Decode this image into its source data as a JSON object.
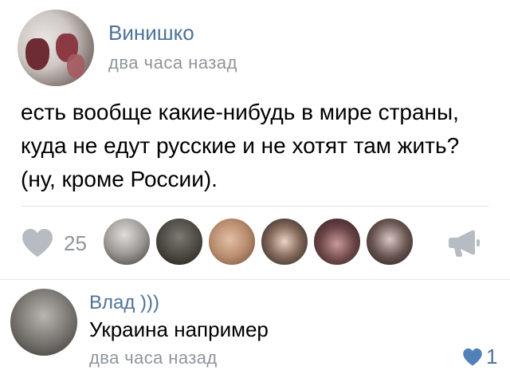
{
  "post": {
    "group_name": "Винишко",
    "time": "два часа назад",
    "text": "есть вообще какие-нибудь в мире страны, куда не едут русские и не хотят там жить? (ну, кроме России).",
    "likes_count": "25",
    "liker_avatars": [
      "liker-avatar",
      "liker-avatar",
      "liker-avatar",
      "liker-avatar",
      "liker-avatar",
      "liker-avatar"
    ],
    "icons": {
      "like": "heart-icon",
      "share": "megaphone-icon"
    }
  },
  "comment": {
    "author": "Влад )))",
    "text": "Украина например",
    "time": "два часа назад",
    "likes_count": "1",
    "icons": {
      "like": "heart-icon"
    }
  },
  "colors": {
    "accent_blue": "#4e729a",
    "meta_gray": "#8f959b",
    "icon_gray": "#b7bcc2",
    "liked_blue": "#5181b8",
    "divider": "#e3e5e8"
  }
}
